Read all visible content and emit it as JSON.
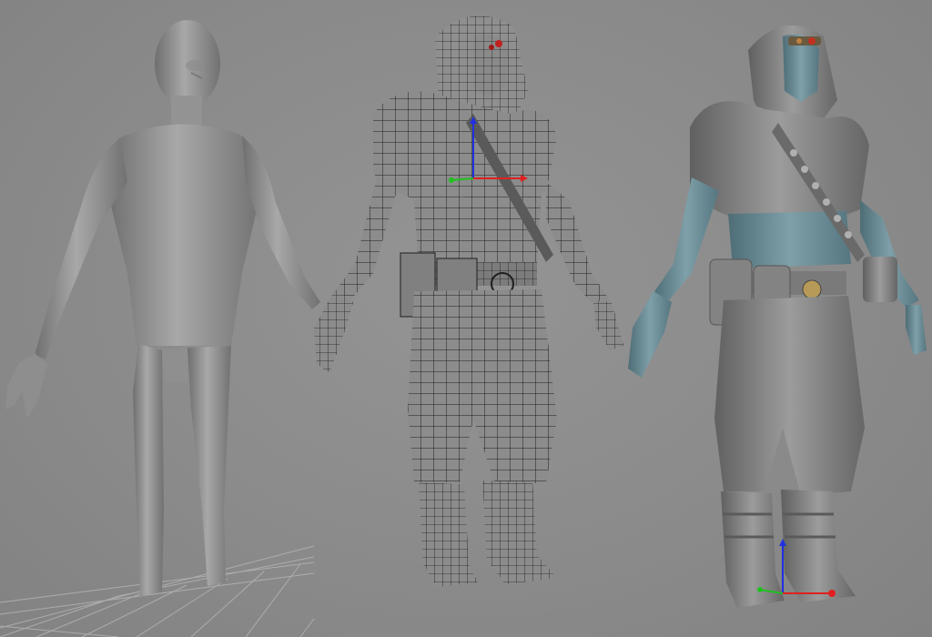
{
  "scene": {
    "background_color": "#8a8a8a",
    "grid_color": "#b4b4b4",
    "models": [
      {
        "id": "base-mesh",
        "style": "smooth-shaded",
        "color": "#9a9a9a"
      },
      {
        "id": "wireframe-mesh",
        "style": "wireframe-over-shaded",
        "color": "#8f8f8f",
        "wire_color": "#1e1e1e"
      },
      {
        "id": "textured-render",
        "style": "shaded-colored",
        "color": "#8c8c8c",
        "skin_color": "#6f8f98"
      }
    ],
    "gizmo_colors": {
      "x": "#e02020",
      "y": "#20c020",
      "z": "#2030e0"
    }
  }
}
